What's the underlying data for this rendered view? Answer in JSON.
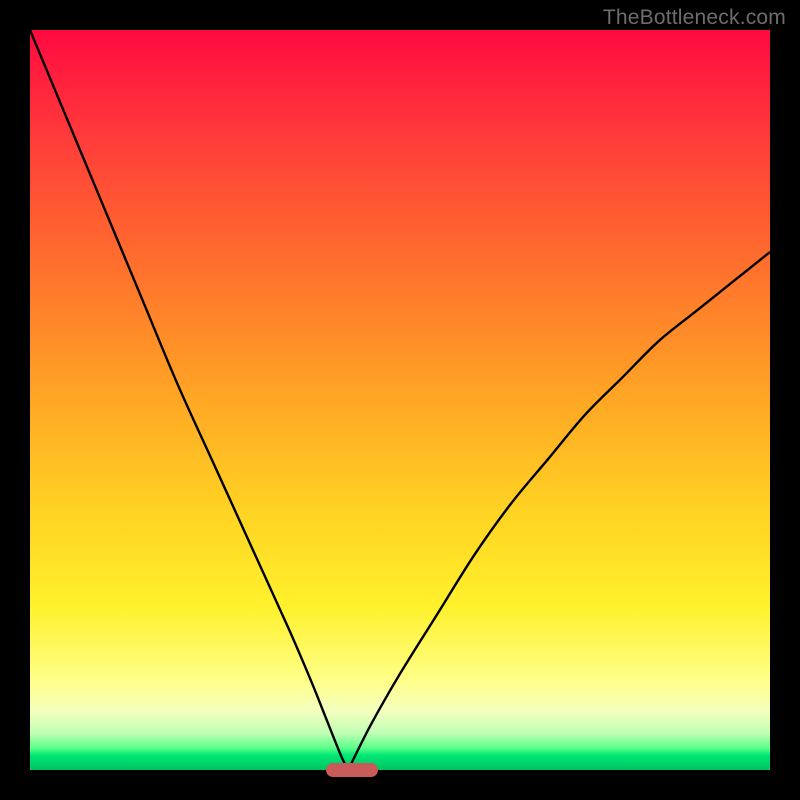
{
  "watermark": "TheBottleneck.com",
  "chart_data": {
    "type": "line",
    "title": "",
    "xlabel": "",
    "ylabel": "",
    "x_range": [
      0,
      100
    ],
    "y_range": [
      0,
      100
    ],
    "description": "Bottleneck deviation curve. Two branches fall from 100% at the edges to 0% at the sweet spot; the minimum is highlighted by a red pill marker. Background colour encodes penalty (red = bad, green = good).",
    "sweet_spot_x": 43,
    "series": [
      {
        "name": "left-branch",
        "x": [
          0,
          5,
          10,
          15,
          20,
          25,
          30,
          35,
          38,
          40,
          42,
          43
        ],
        "y": [
          100,
          88,
          76,
          64,
          52,
          41,
          30,
          19,
          12,
          7,
          2,
          0
        ]
      },
      {
        "name": "right-branch",
        "x": [
          43,
          46,
          50,
          55,
          60,
          65,
          70,
          75,
          80,
          85,
          90,
          95,
          100
        ],
        "y": [
          0,
          6,
          13,
          21,
          29,
          36,
          42,
          48,
          53,
          58,
          62,
          66,
          70
        ]
      }
    ],
    "marker": {
      "x_start": 40,
      "x_end": 47,
      "y": 0
    },
    "gradient_stops": [
      {
        "pos": 0.0,
        "color": "#ff0a40"
      },
      {
        "pos": 0.5,
        "color": "#ffa724"
      },
      {
        "pos": 0.8,
        "color": "#fff12c"
      },
      {
        "pos": 1.0,
        "color": "#00c361"
      }
    ]
  }
}
